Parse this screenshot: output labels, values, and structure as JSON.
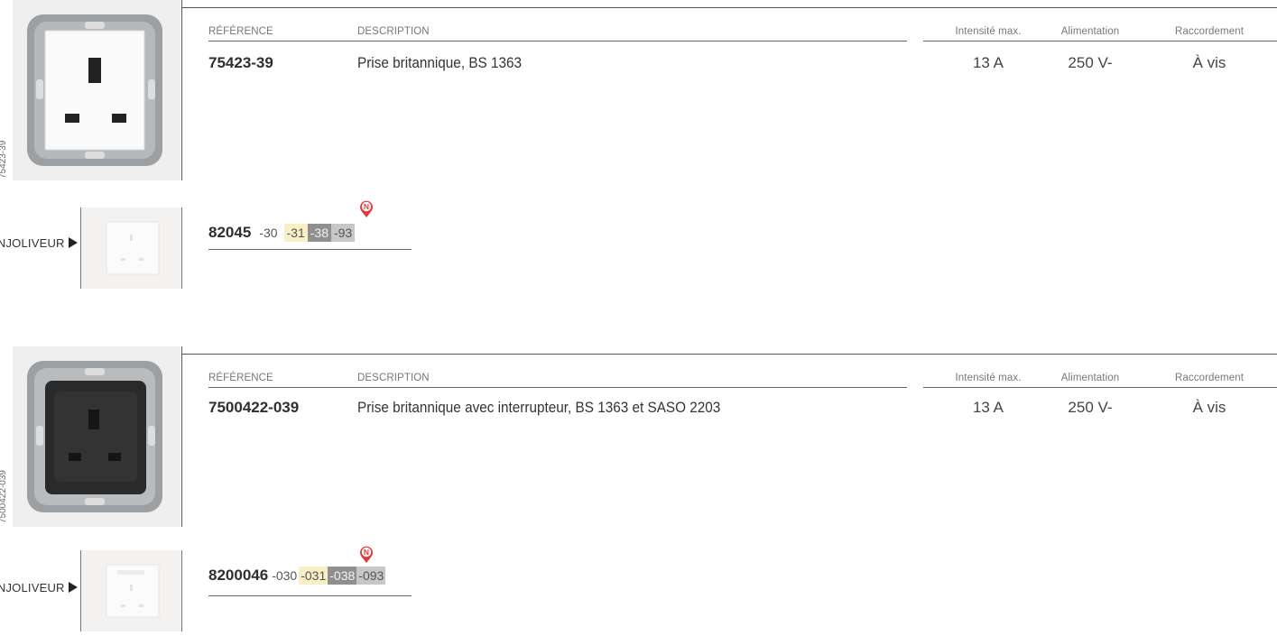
{
  "colors": {
    "accent_new_badge": "#e23a3a",
    "swatch_cream": "#f7efc6",
    "swatch_dark": "#8f8f8f",
    "swatch_grey": "#c7c7c7",
    "rule": "#555555"
  },
  "headers": {
    "reference": "RÉFÉRENCE",
    "description": "DESCRIPTION",
    "intensity": "Intensité max.",
    "supply": "Alimentation",
    "connection": "Raccordement"
  },
  "products": [
    {
      "side_code": "75423-39",
      "reference": "75423-39",
      "description": "Prise britannique, BS 1363",
      "intensity": "13 A",
      "supply": "250 V-",
      "connection": "À vis",
      "enjoliveur_label": "ENJOLIVEUR",
      "cover_code": "82045",
      "new_icon": "n-new-badge-icon",
      "suffixes": [
        "-30",
        "-31",
        "-38",
        "-93"
      ]
    },
    {
      "side_code": "7500422-039",
      "reference": "7500422-039",
      "description": "Prise britannique avec interrupteur, BS 1363 et SASO 2203",
      "intensity": "13 A",
      "supply": "250 V-",
      "connection": "À vis",
      "enjoliveur_label": "ENJOLIVEUR",
      "cover_code": "8200046",
      "new_icon": "n-new-badge-icon",
      "suffixes": [
        "-030",
        "-031",
        "-038",
        "-093"
      ]
    }
  ]
}
